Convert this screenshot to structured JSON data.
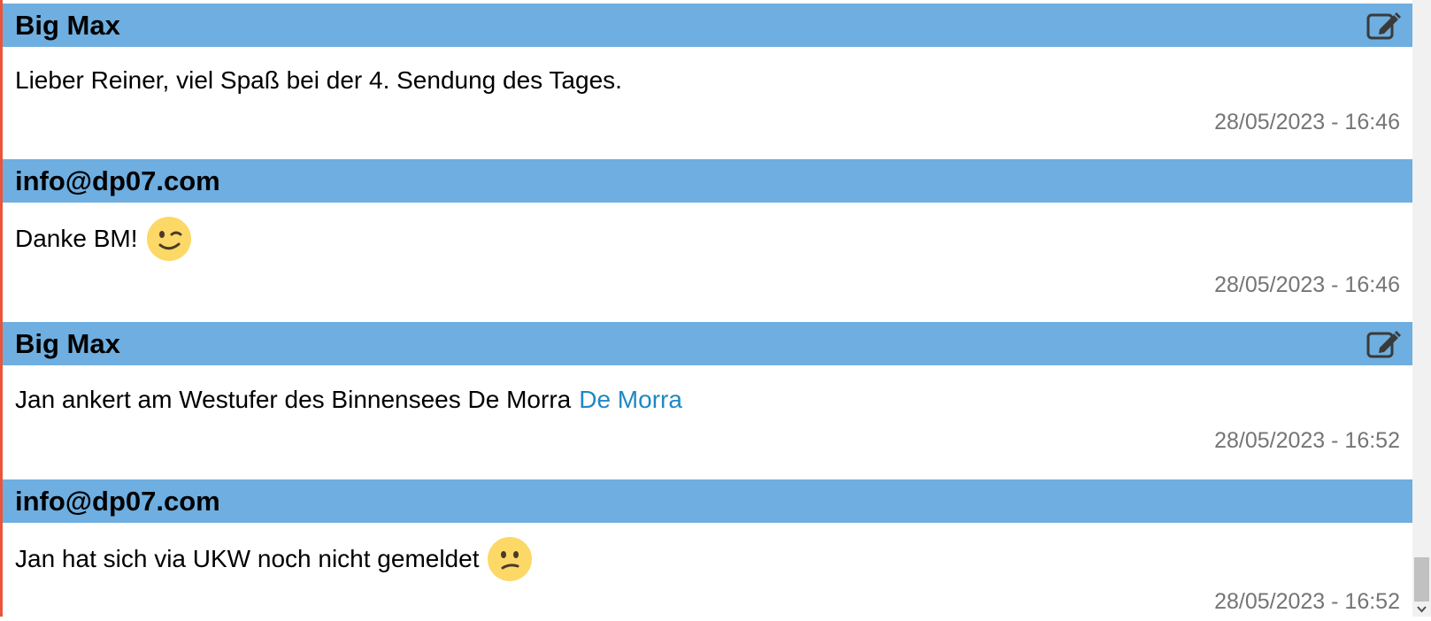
{
  "messages": [
    {
      "author": "Big Max",
      "text": "Lieber Reiner, viel Spaß bei der 4. Sendung des Tages.",
      "link": "",
      "emoji": "",
      "timestamp": "28/05/2023 - 16:46",
      "editable": true
    },
    {
      "author": "info@dp07.com",
      "text": "Danke BM!",
      "link": "",
      "emoji": "wink-emoji",
      "timestamp": "28/05/2023 - 16:46",
      "editable": false
    },
    {
      "author": "Big Max",
      "text": "Jan ankert am Westufer des Binnensees De Morra",
      "link": "De Morra",
      "emoji": "",
      "timestamp": "28/05/2023 - 16:52",
      "editable": true
    },
    {
      "author": "info@dp07.com",
      "text": "Jan hat sich via UKW noch nicht gemeldet",
      "link": "",
      "emoji": "confused-emoji",
      "timestamp": "28/05/2023 - 16:52",
      "editable": false
    }
  ],
  "icons": {
    "edit": "edit-icon"
  },
  "colors": {
    "header_bg": "#6eaee0",
    "link": "#1f88c4",
    "timestamp": "#757575",
    "left_accent": "#e8553a"
  }
}
